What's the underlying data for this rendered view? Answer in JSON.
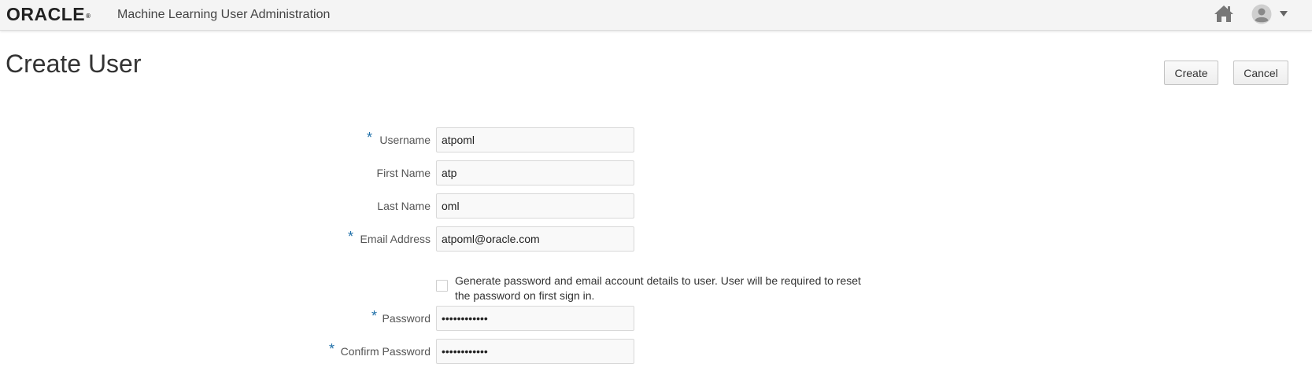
{
  "header": {
    "logo_text": "ORACLE",
    "app_title": "Machine Learning User Administration",
    "icons": [
      "home-icon",
      "user-avatar-icon",
      "caret-down-icon"
    ]
  },
  "page": {
    "title": "Create User",
    "create_label": "Create",
    "cancel_label": "Cancel"
  },
  "form": {
    "username": {
      "label": "Username",
      "value": "atpoml",
      "required": true
    },
    "first_name": {
      "label": "First Name",
      "value": "atp",
      "required": false
    },
    "last_name": {
      "label": "Last Name",
      "value": "oml",
      "required": false
    },
    "email": {
      "label": "Email Address",
      "value": "atpoml@oracle.com",
      "required": true
    },
    "generate_password": {
      "label": "Generate password and email account details to user. User will be required to reset the password on first sign in.",
      "checked": false
    },
    "password": {
      "label": "Password",
      "value": "••••••••••••",
      "required": true
    },
    "confirm_password": {
      "label": "Confirm Password",
      "value": "••••••••••••",
      "required": true
    },
    "required_marker": "*"
  },
  "colors": {
    "required_marker": "#1e6fa8",
    "header_bg": "#f4f4f4"
  }
}
